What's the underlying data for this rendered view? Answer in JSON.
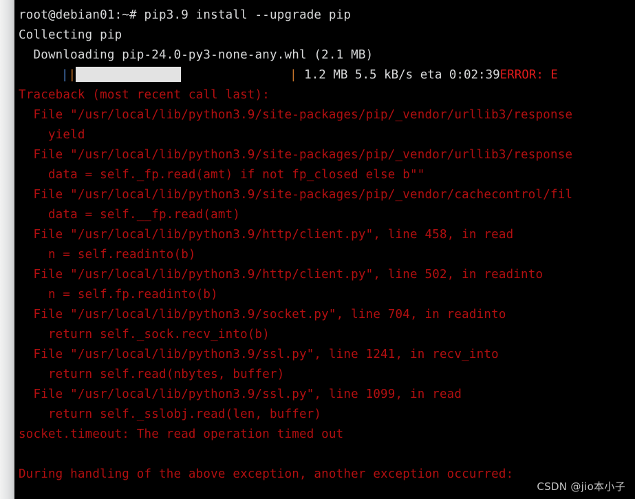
{
  "window": {
    "background_color": "#000000",
    "scrollbar_color": "#e2e3e4"
  },
  "colors": {
    "foreground": "#d9dadb",
    "error_red": "#b20f10",
    "bright_red": "#e01b1b",
    "progress_orange": "#c8752a",
    "progress_cursor_blue": "#4b80c8",
    "progress_fill": "#e3e3e3"
  },
  "terminal": {
    "prompt": "root@debian01:~# ",
    "command": "pip3.9 install --upgrade pip",
    "lines": [
      {
        "id": "clipped-top",
        "text": "",
        "color": "white"
      },
      {
        "id": "prompt-line",
        "text": "root@debian01:~# pip3.9 install --upgrade pip",
        "color": "white"
      },
      {
        "id": "collecting",
        "text": "Collecting pip",
        "color": "white"
      },
      {
        "id": "downloading",
        "text": "  Downloading pip-24.0-py3-none-any.whl (2.1 MB)",
        "color": "white"
      }
    ],
    "progress": {
      "cursor": "|",
      "left_edge": "|",
      "right_edge": "|",
      "stats": " 1.2 MB 5.5 kB/s eta 0:02:39",
      "error_fragment": "ERROR: E",
      "downloaded": "1.2 MB",
      "speed": "5.5 kB/s",
      "eta": "0:02:39",
      "total_size": "2.1 MB",
      "package": "pip-24.0-py3-none-any.whl"
    },
    "traceback": [
      {
        "id": "tb-header",
        "text": "Traceback (most recent call last):"
      },
      {
        "id": "tb-file-1",
        "text": "  File \"/usr/local/lib/python3.9/site-packages/pip/_vendor/urllib3/response"
      },
      {
        "id": "tb-code-1",
        "text": "    yield"
      },
      {
        "id": "tb-file-2",
        "text": "  File \"/usr/local/lib/python3.9/site-packages/pip/_vendor/urllib3/response"
      },
      {
        "id": "tb-code-2",
        "text": "    data = self._fp.read(amt) if not fp_closed else b\"\""
      },
      {
        "id": "tb-file-3",
        "text": "  File \"/usr/local/lib/python3.9/site-packages/pip/_vendor/cachecontrol/fil"
      },
      {
        "id": "tb-code-3",
        "text": "    data = self.__fp.read(amt)"
      },
      {
        "id": "tb-file-4",
        "text": "  File \"/usr/local/lib/python3.9/http/client.py\", line 458, in read"
      },
      {
        "id": "tb-code-4",
        "text": "    n = self.readinto(b)"
      },
      {
        "id": "tb-file-5",
        "text": "  File \"/usr/local/lib/python3.9/http/client.py\", line 502, in readinto"
      },
      {
        "id": "tb-code-5",
        "text": "    n = self.fp.readinto(b)"
      },
      {
        "id": "tb-file-6",
        "text": "  File \"/usr/local/lib/python3.9/socket.py\", line 704, in readinto"
      },
      {
        "id": "tb-code-6",
        "text": "    return self._sock.recv_into(b)"
      },
      {
        "id": "tb-file-7",
        "text": "  File \"/usr/local/lib/python3.9/ssl.py\", line 1241, in recv_into"
      },
      {
        "id": "tb-code-7",
        "text": "    return self.read(nbytes, buffer)"
      },
      {
        "id": "tb-file-8",
        "text": "  File \"/usr/local/lib/python3.9/ssl.py\", line 1099, in read"
      },
      {
        "id": "tb-code-8",
        "text": "    return self._sslobj.read(len, buffer)"
      },
      {
        "id": "tb-exception",
        "text": "socket.timeout: The read operation timed out"
      },
      {
        "id": "tb-blank",
        "text": ""
      },
      {
        "id": "tb-chain",
        "text": "During handling of the above exception, another exception occurred:"
      }
    ]
  },
  "watermark": {
    "text": "CSDN @jio本小子"
  }
}
